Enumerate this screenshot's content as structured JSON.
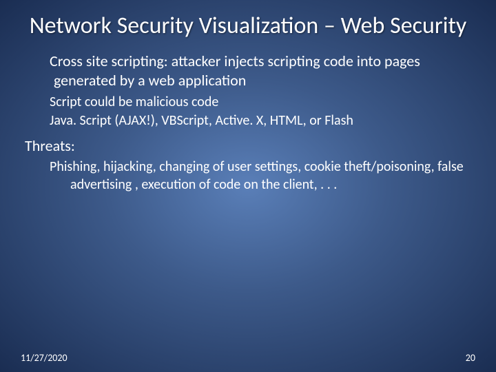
{
  "title": "Network Security Visualization – Web Security",
  "p1": "Cross site scripting: attacker injects scripting code into pages generated by a web application",
  "sub1": "Script could be malicious code",
  "sub2": "Java. Script (AJAX!), VBScript, Active. X, HTML, or Flash",
  "threats_label": "Threats:",
  "threats_body": "Phishing, hijacking, changing of user settings, cookie theft/poisoning, false advertising , execution of code on the client, . . .",
  "footer": {
    "date": "11/27/2020",
    "page": "20"
  }
}
